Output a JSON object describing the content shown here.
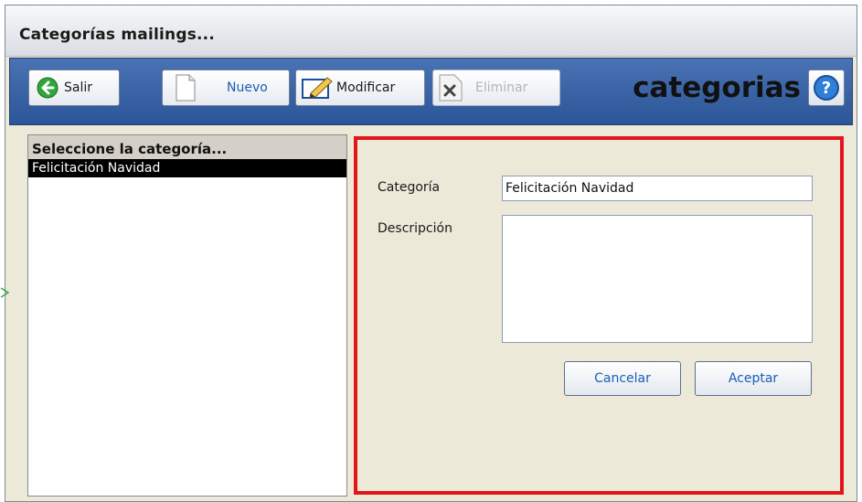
{
  "window": {
    "title": "Categorías mailings..."
  },
  "toolbar": {
    "salir_label": "Salir",
    "nuevo_label": "Nuevo",
    "modificar_label": "Modificar",
    "eliminar_label": "Eliminar",
    "heading": "categorias",
    "accent": "#2b5596"
  },
  "list": {
    "header": "Seleccione la categoría...",
    "items": [
      "Felicitación Navidad"
    ]
  },
  "form": {
    "categoria_label": "Categoría",
    "categoria_value": "Felicitación Navidad",
    "descripcion_label": "Descripción",
    "descripcion_value": "",
    "cancel_label": "Cancelar",
    "accept_label": "Aceptar",
    "highlight_color": "#e3151a"
  },
  "icons": [
    "back-arrow-icon",
    "new-document-icon",
    "edit-pencil-icon",
    "delete-x-icon",
    "help-question-icon"
  ]
}
